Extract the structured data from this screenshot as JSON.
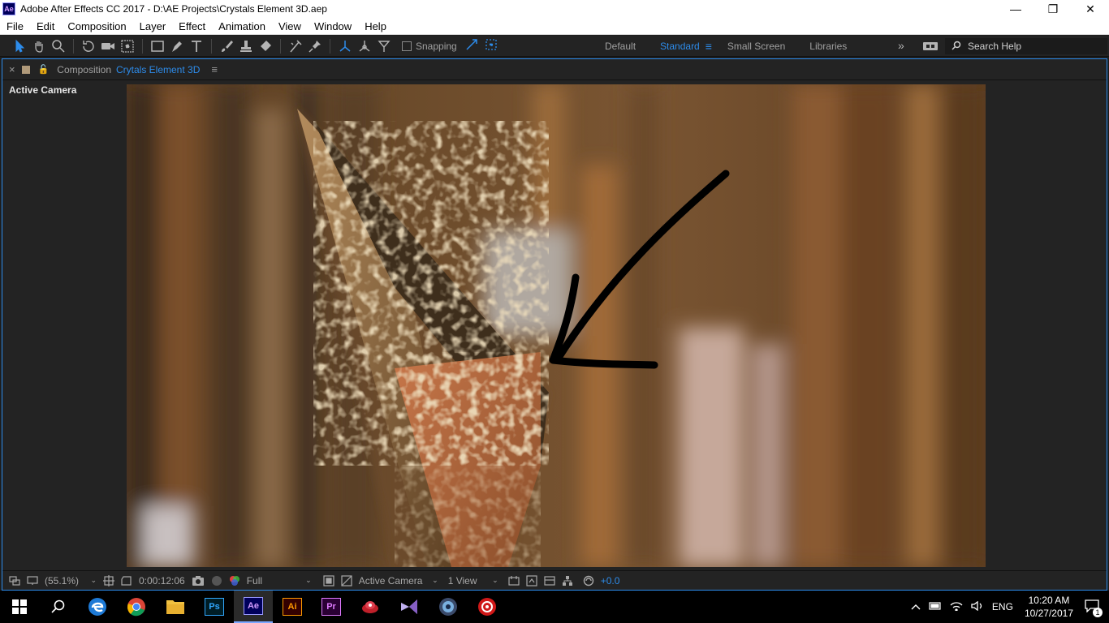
{
  "window": {
    "app_icon_label": "Ae",
    "title": "Adobe After Effects CC 2017 - D:\\AE Projects\\Crystals Element 3D.aep",
    "minimize": "—",
    "restore": "❐",
    "close": "✕"
  },
  "menu": [
    "File",
    "Edit",
    "Composition",
    "Layer",
    "Effect",
    "Animation",
    "View",
    "Window",
    "Help"
  ],
  "toolbar": {
    "snapping_label": "Snapping",
    "workspaces": [
      "Default",
      "Standard",
      "Small Screen",
      "Libraries"
    ],
    "active_workspace": "Standard",
    "more_label": "»",
    "search_placeholder": "Search Help"
  },
  "panel": {
    "close": "×",
    "label": "Composition",
    "comp_name": "Crytals Element 3D",
    "menu": "≡",
    "active_camera": "Active Camera"
  },
  "footer": {
    "zoom": "(55.1%)",
    "timecode": "0:00:12:06",
    "resolution": "Full",
    "view_camera": "Active Camera",
    "views": "1 View",
    "exposure": "+0.0"
  },
  "taskbar": {
    "apps": [
      "start",
      "search",
      "edge",
      "chrome",
      "file-explorer",
      "photoshop",
      "after-effects",
      "illustrator",
      "premiere",
      "app-red",
      "visual-studio",
      "app-blue",
      "app-red-2"
    ],
    "ae_label": "Ae",
    "ai_label": "Ai",
    "pr_label": "Pr",
    "ps_label": "Ps",
    "language": "ENG",
    "time": "10:20 AM",
    "date": "10/27/2017",
    "notification_count": "1"
  },
  "colors": {
    "accent": "#2d8ceb",
    "ae_purple": "#d29bff",
    "ae_bg": "#00005b"
  }
}
